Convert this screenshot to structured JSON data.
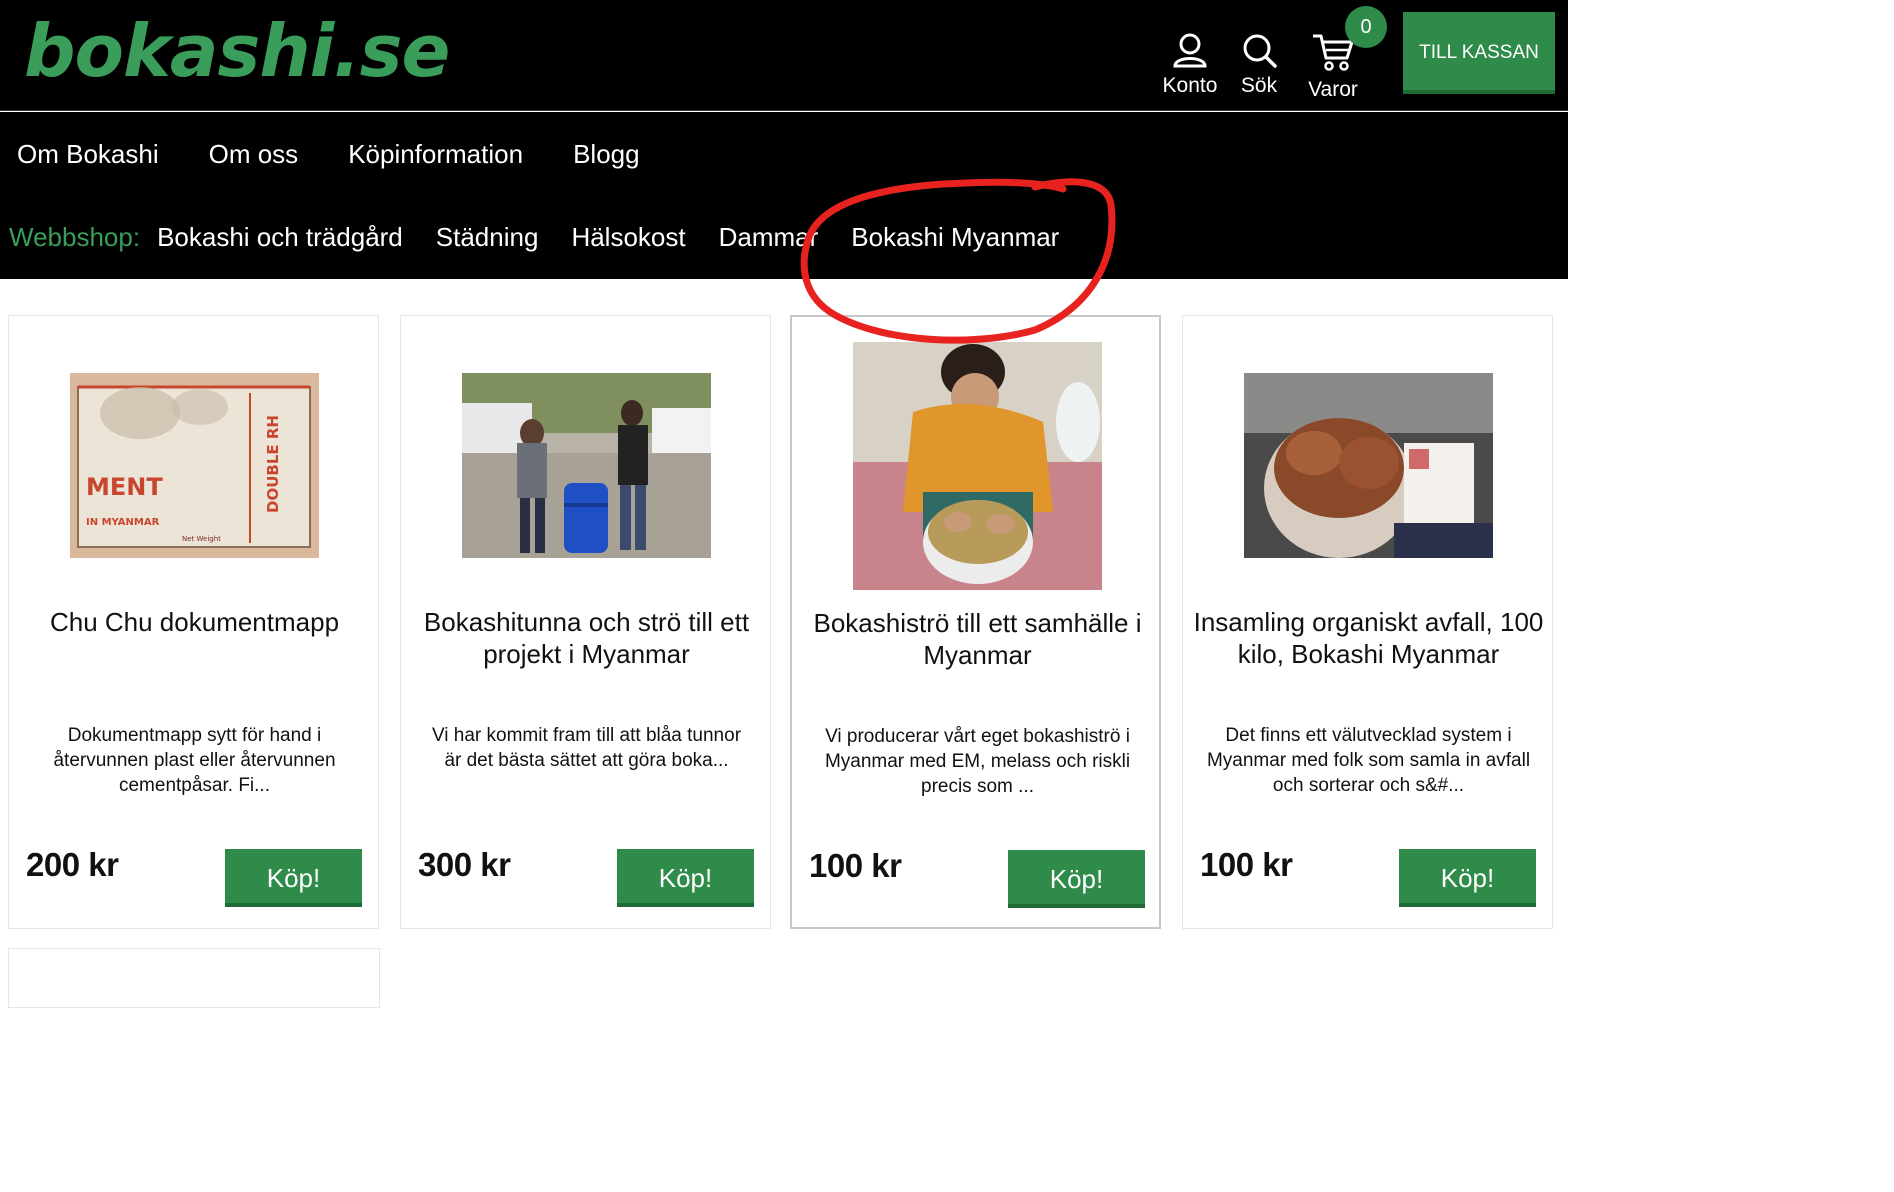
{
  "header": {
    "logo": "bokashi.se",
    "account_label": "Konto",
    "search_label": "Sök",
    "cart_label": "Varor",
    "cart_count": "0",
    "checkout_label": "TILL KASSAN"
  },
  "nav": {
    "main": [
      "Om Bokashi",
      "Om oss",
      "Köpinformation",
      "Blogg"
    ],
    "shop_label": "Webbshop:",
    "shop": [
      "Bokashi och trädgård",
      "Städning",
      "Hälsokost",
      "Dammar",
      "Bokashi Myanmar"
    ]
  },
  "annotation": {
    "color": "#e8231f"
  },
  "products": [
    {
      "title": "Chu Chu dokumentmapp",
      "desc": "Dokumentmapp sytt för hand i återvunnen plast eller återvunnen cementpåsar. Fi...",
      "price": "200 kr",
      "buy": "Köp!",
      "image_text": [
        "MENT",
        "IN MYANMAR",
        "DOUBLE RH",
        "Net Weight"
      ]
    },
    {
      "title": "Bokashitunna och strö till ett projekt i Myanmar",
      "desc": "Vi har kommit fram till att blåa tunnor är det bästa sättet att göra boka...",
      "price": "300 kr",
      "buy": "Köp!"
    },
    {
      "title": "Bokashiströ till ett samhälle i Myanmar",
      "desc": "Vi producerar vårt eget bokashiströ i Myanmar med EM, melass och riskli precis som ...",
      "price": "100 kr",
      "buy": "Köp!"
    },
    {
      "title": "Insamling organiskt avfall, 100 kilo, Bokashi Myanmar",
      "desc": "Det finns ett välutvecklad system i Myanmar med folk som samla in avfall och sorterar och s&#...",
      "price": "100 kr",
      "buy": "Köp!"
    }
  ],
  "colors": {
    "brand_green": "#3a9d5a",
    "button_green": "#2e8b4a",
    "header_bg": "#000000"
  }
}
